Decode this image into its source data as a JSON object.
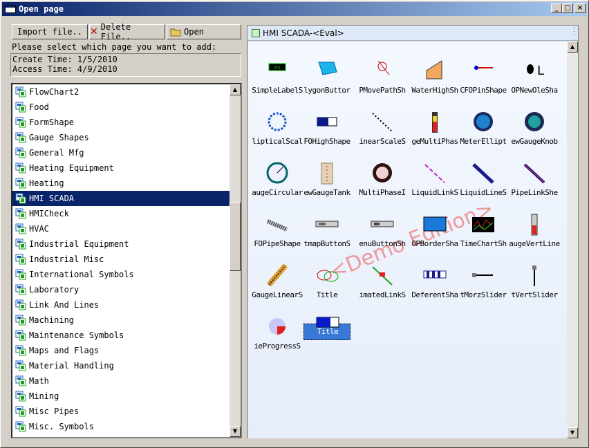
{
  "window": {
    "title": "Open page"
  },
  "toolbar": {
    "import_label": "Import file..",
    "delete_label": "Delete File..",
    "open_label": "Open"
  },
  "prompt": "Please select which page you want to add:",
  "info": {
    "create": "Create Time: 1/5/2010",
    "access": "Access Time: 4/9/2010"
  },
  "pages": [
    "FlowChart2",
    "Food",
    "FormShape",
    "Gauge Shapes",
    "General Mfg",
    "Heating Equipment",
    "Heating",
    "HMI SCADA",
    "HMICheck",
    "HVAC",
    "Industrial Equipment",
    "Industrial Misc",
    "International Symbols",
    "Laboratory",
    "Link And Lines",
    "Machining",
    "Maintenance Symbols",
    "Maps and Flags",
    "Material Handling",
    "Math",
    "Mining",
    "Misc Pipes",
    "Misc. Symbols"
  ],
  "selected_page": "HMI SCADA",
  "panel": {
    "title": "HMI SCADA-<Eval>"
  },
  "shapes": [
    [
      "SimpleLabelS",
      "lygonButtor",
      "PMovePathSh",
      "WaterHighSh",
      "CFOPinShape",
      "OPNewOleSha"
    ],
    [
      "lipticalScal",
      "FOHighShape",
      "inearScaleS",
      "geMultiPhas",
      "MeterEllipt",
      "ewGaugeKnob"
    ],
    [
      "augeCircular",
      "ewGaugeTank",
      "MultiPhaseI",
      "LiquidLinkS",
      "LiquidLineS",
      "PipeLinkShe"
    ],
    [
      "FOPipeShape",
      "tmapButtonS",
      "enuButtonSh",
      "OPBorderSha",
      "TimeChartSh",
      "augeVertLine"
    ],
    [
      "GaugeLinearS",
      "Title",
      "imatedLinkS",
      "DeferentSha",
      "tMorzSlider",
      "tVertSlider"
    ],
    [
      "ieProgressS",
      "Title"
    ]
  ],
  "watermark": "<Demo Edition>",
  "colors": {
    "titlebar": "#0a246a",
    "selection": "#0a246a",
    "tile_selection": "#3a78d8",
    "watermark": "#f07a7a"
  }
}
